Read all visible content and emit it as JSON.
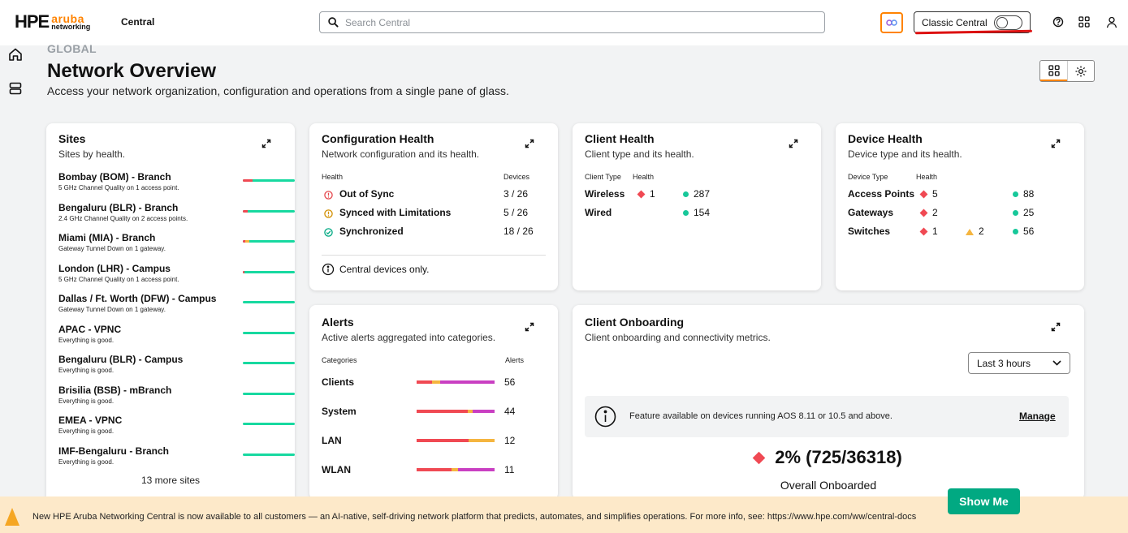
{
  "header": {
    "logo_brand": "HPE",
    "logo_aruba": "aruba",
    "logo_networking": "networking",
    "app_name": "Central",
    "search_placeholder": "Search Central",
    "classic_label": "Classic Central",
    "icons": [
      "search-icon",
      "ai-assistant-icon",
      "help-icon",
      "apps-grid-icon",
      "user-icon"
    ]
  },
  "rail": {
    "icons": [
      "home-icon",
      "stack-icon"
    ]
  },
  "page": {
    "scope": "GLOBAL",
    "title": "Network Overview",
    "subtitle": "Access your network organization, configuration and operations from a single pane of glass."
  },
  "sites": {
    "title": "Sites",
    "subtitle": "Sites by health.",
    "items": [
      {
        "name": "Bombay (BOM) - Branch",
        "desc": "5 GHz Channel Quality on 1 access point.",
        "bad": 0.18,
        "warn": 0
      },
      {
        "name": "Bengaluru (BLR) - Branch",
        "desc": "2.4 GHz Channel Quality on 2 access points.",
        "bad": 0.1,
        "warn": 0
      },
      {
        "name": "Miami (MIA) - Branch",
        "desc": "Gateway Tunnel Down on 1 gateway.",
        "bad": 0.05,
        "warn": 0.08
      },
      {
        "name": "London (LHR) - Campus",
        "desc": "5 GHz Channel Quality on 1 access point.",
        "bad": 0.03,
        "warn": 0
      },
      {
        "name": "Dallas / Ft. Worth (DFW) - Campus",
        "desc": "Gateway Tunnel Down on 1 gateway.",
        "bad": 0,
        "warn": 0
      },
      {
        "name": "APAC - VPNC",
        "desc": "Everything is good.",
        "bad": 0,
        "warn": 0
      },
      {
        "name": "Bengaluru (BLR) - Campus",
        "desc": "Everything is good.",
        "bad": 0,
        "warn": 0
      },
      {
        "name": "Brisilia (BSB) - mBranch",
        "desc": "Everything is good.",
        "bad": 0,
        "warn": 0
      },
      {
        "name": "EMEA - VPNC",
        "desc": "Everything is good.",
        "bad": 0,
        "warn": 0
      },
      {
        "name": "IMF-Bengaluru - Branch",
        "desc": "Everything is good.",
        "bad": 0,
        "warn": 0
      }
    ],
    "more": "13 more sites"
  },
  "config_health": {
    "title": "Configuration Health",
    "subtitle": "Network configuration and its health.",
    "col_health": "Health",
    "col_devices": "Devices",
    "rows": [
      {
        "label": "Out of Sync",
        "value": "3 / 26",
        "icon": "error-icon",
        "color": "#e5484d"
      },
      {
        "label": "Synced with Limitations",
        "value": "5 / 26",
        "icon": "warning-icon",
        "color": "#d18f00"
      },
      {
        "label": "Synchronized",
        "value": "18 / 26",
        "icon": "check-icon",
        "color": "#01a982"
      }
    ],
    "note": "Central devices only."
  },
  "client_health": {
    "title": "Client Health",
    "subtitle": "Client type and its health.",
    "col_type": "Client Type",
    "col_health": "Health",
    "rows": [
      {
        "type": "Wireless",
        "bad": "1",
        "good": "287"
      },
      {
        "type": "Wired",
        "bad": "",
        "good": "154"
      }
    ]
  },
  "device_health": {
    "title": "Device Health",
    "subtitle": "Device type and its health.",
    "col_type": "Device Type",
    "col_health": "Health",
    "rows": [
      {
        "type": "Access Points",
        "bad": "5",
        "warn": "",
        "good": "88"
      },
      {
        "type": "Gateways",
        "bad": "2",
        "warn": "",
        "good": "25"
      },
      {
        "type": "Switches",
        "bad": "1",
        "warn": "2",
        "good": "56"
      }
    ]
  },
  "alerts": {
    "title": "Alerts",
    "subtitle": "Active alerts aggregated into categories.",
    "col_categories": "Categories",
    "col_alerts": "Alerts",
    "rows": [
      {
        "label": "Clients",
        "value": "56",
        "segments": [
          0.2,
          0.1,
          0.7
        ]
      },
      {
        "label": "System",
        "value": "44",
        "segments": [
          0.66,
          0.06,
          0.28
        ]
      },
      {
        "label": "LAN",
        "value": "12",
        "segments": [
          0.67,
          0.33,
          0
        ]
      },
      {
        "label": "WLAN",
        "value": "11",
        "segments": [
          0.45,
          0.08,
          0.47
        ]
      }
    ],
    "segment_colors": [
      "#f04953",
      "#f5b53f",
      "#c93fc2"
    ]
  },
  "onboarding": {
    "title": "Client Onboarding",
    "subtitle": "Client onboarding and connectivity metrics.",
    "range": "Last 3 hours",
    "info": "Feature available on devices running AOS 8.11 or 10.5 and above.",
    "manage": "Manage",
    "metric": "2% (725/36318)",
    "metric_label": "Overall Onboarded"
  },
  "banner": {
    "text": "New HPE Aruba Networking Central is now available to all customers — an AI-native, self-driving network platform that predicts, automates, and simplifies operations. For more info, see: https://www.hpe.com/ww/central-docs",
    "button": "Show Me"
  },
  "colors": {
    "accent": "#ff8300",
    "good": "#17d9a0",
    "bad": "#f04953",
    "warn": "#f5b53f",
    "brand_green": "#01a982"
  }
}
